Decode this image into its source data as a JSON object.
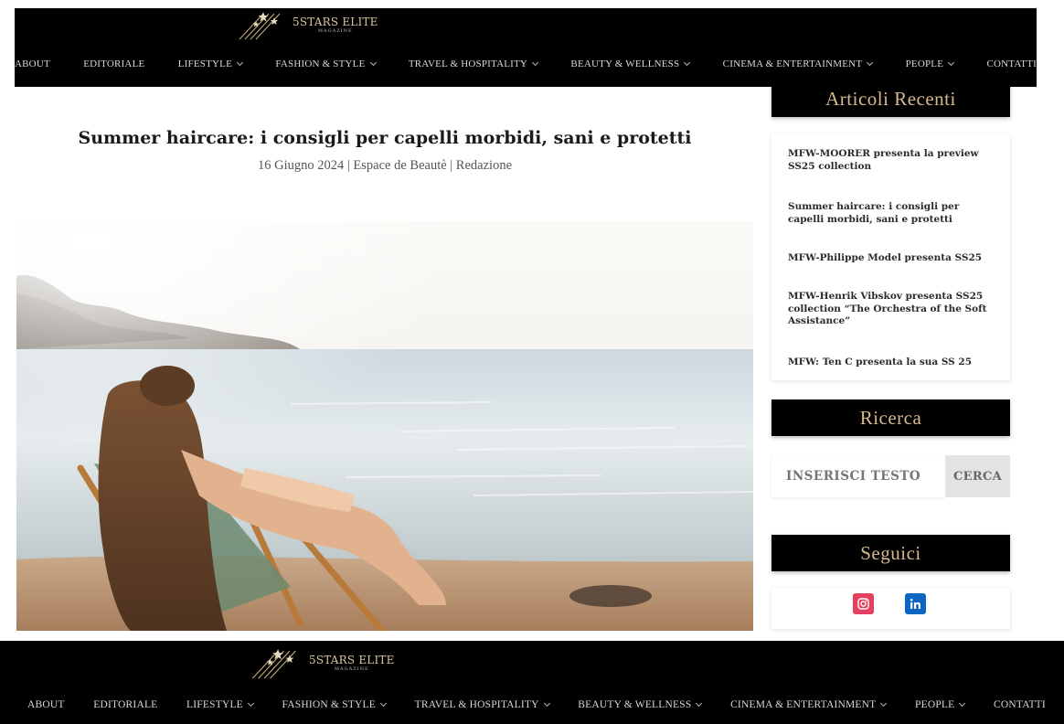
{
  "brand": {
    "name": "5STARS ELITE",
    "sub": "MAGAZINE"
  },
  "nav": {
    "items": [
      {
        "label": "ABOUT",
        "dropdown": false
      },
      {
        "label": "EDITORIALE",
        "dropdown": false
      },
      {
        "label": "LIFESTYLE",
        "dropdown": true
      },
      {
        "label": "FASHION & STYLE",
        "dropdown": true
      },
      {
        "label": "TRAVEL & HOSPITALITY",
        "dropdown": true
      },
      {
        "label": "BEAUTY & WELLNESS",
        "dropdown": true
      },
      {
        "label": "CINEMA & ENTERTAINMENT",
        "dropdown": true
      },
      {
        "label": "PEOPLE",
        "dropdown": true
      },
      {
        "label": "CONTATTI",
        "dropdown": false
      }
    ]
  },
  "article": {
    "title": "Summer haircare: i consigli per capelli morbidi, sani e protetti",
    "meta": "16 Giugno 2024 | Espace de Beautè | Redazione"
  },
  "sidebar": {
    "recent_title": "Articoli Recenti",
    "recent": [
      "MFW-MOORER presenta la preview SS25 collection",
      "Summer haircare: i consigli per capelli morbidi, sani e protetti",
      "MFW-Philippe Model presenta SS25",
      "MFW-Henrik Vibskov presenta SS25 collection “The Orchestra of the Soft Assistance”",
      "MFW: Ten C presenta la sua SS 25"
    ],
    "search_title": "Ricerca",
    "search_placeholder": "INSERISCI TESTO",
    "search_button": "CERCA",
    "follow_title": "Seguici",
    "social": [
      {
        "icon": "instagram-icon",
        "color": "#e4405f"
      },
      {
        "icon": "linkedin-icon",
        "color": "#0a66c2"
      }
    ]
  },
  "colors": {
    "header_bg": "#000000",
    "accent_gold": "#d8b98c"
  }
}
